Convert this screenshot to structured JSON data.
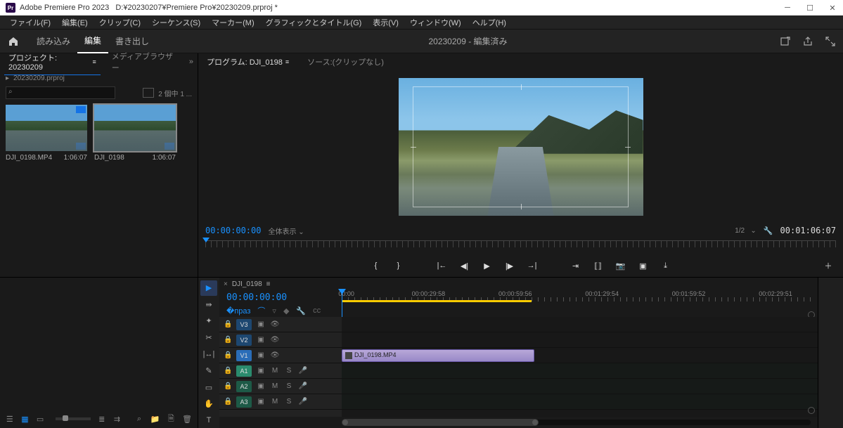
{
  "titlebar": {
    "app": "Adobe Premiere Pro 2023",
    "project_path": "D:¥20230207¥Premiere Pro¥20230209.prproj *"
  },
  "menubar": [
    "ファイル(F)",
    "編集(E)",
    "クリップ(C)",
    "シーケンス(S)",
    "マーカー(M)",
    "グラフィックとタイトル(G)",
    "表示(V)",
    "ウィンドウ(W)",
    "ヘルプ(H)"
  ],
  "workspace": {
    "tabs": [
      "読み込み",
      "編集",
      "書き出し"
    ],
    "active_index": 1,
    "center": "20230209 - 編集済み"
  },
  "project_panel": {
    "tab_active": "プロジェクト: 20230209",
    "tab_other": "メディアブラウザー",
    "breadcrumb": "20230209.prproj",
    "search_placeholder": "",
    "count": "2 個中 1 ...",
    "items": [
      {
        "name": "DJI_0198.MP4",
        "dur": "1:06:07",
        "selected": false
      },
      {
        "name": "DJI_0198",
        "dur": "1:06:07",
        "selected": true
      }
    ]
  },
  "program_panel": {
    "tab": "プログラム: DJI_0198",
    "source_tab": "ソース:(クリップなし)",
    "tc_left": "00:00:00:00",
    "fit": "全体表示",
    "zoom": "1/2",
    "tc_right": "00:01:06:07"
  },
  "timeline": {
    "seq_name": "DJI_0198",
    "tc": "00:00:00:00",
    "ruler_labels": [
      "00:00",
      "00:00:29:58",
      "00:00:59:56",
      "00:01:29:54",
      "00:01:59:52",
      "00:02:29:51"
    ],
    "yellow_in_out_pct": 40.5,
    "video_tracks": [
      "V3",
      "V2",
      "V1"
    ],
    "audio_tracks": [
      "A1",
      "A2",
      "A3"
    ],
    "clip": {
      "name": "DJI_0198.MP4",
      "start_pct": 0,
      "width_pct": 40.5
    }
  }
}
